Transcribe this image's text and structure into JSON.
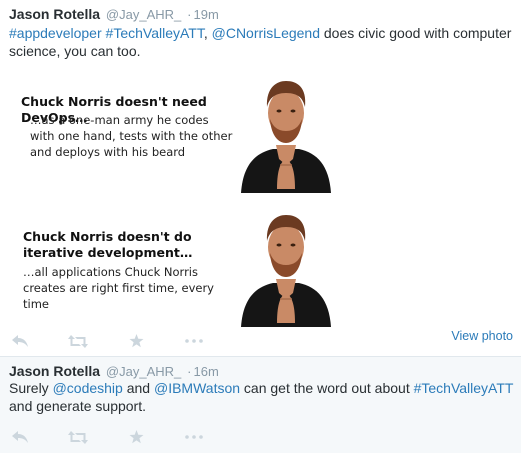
{
  "tweets": [
    {
      "fullname": "Jason Rotella",
      "username": "@Jay_AHR_",
      "sep": "·",
      "time": "19m",
      "text": [
        {
          "t": "#appdeveloper",
          "link": true
        },
        {
          "t": " ",
          "link": false
        },
        {
          "t": "#TechValleyATT",
          "link": true
        },
        {
          "t": ", ",
          "link": false
        },
        {
          "t": "@CNorrisLegend",
          "link": true
        },
        {
          "t": " does civic good with computer science, you can too.",
          "link": false
        }
      ],
      "media": {
        "slides": [
          {
            "title": "Chuck Norris doesn't need DevOps…",
            "body": "…as a one-man army he codes with one hand, tests with the other and deploys with his beard"
          },
          {
            "title": "Chuck Norris doesn't do iterative development…",
            "body": "…all applications Chuck Norris creates are right first time, every time"
          }
        ],
        "view_label": "View photo"
      }
    },
    {
      "fullname": "Jason Rotella",
      "username": "@Jay_AHR_",
      "sep": "·",
      "time": "16m",
      "text": [
        {
          "t": "Surely ",
          "link": false
        },
        {
          "t": "@codeship",
          "link": true
        },
        {
          "t": " and ",
          "link": false
        },
        {
          "t": "@IBMWatson",
          "link": true
        },
        {
          "t": " can get the word out about ",
          "link": false
        },
        {
          "t": "#TechValleyATT",
          "link": true
        },
        {
          "t": " and generate support.",
          "link": false
        }
      ]
    }
  ],
  "actions": [
    "reply-icon",
    "retweet-icon",
    "favorite-icon",
    "more-icon"
  ],
  "colors": {
    "link": "#2b7bb9",
    "muted": "#8899a6",
    "icon": "#ccd6dd",
    "alt_bg": "#f5f8fa"
  }
}
